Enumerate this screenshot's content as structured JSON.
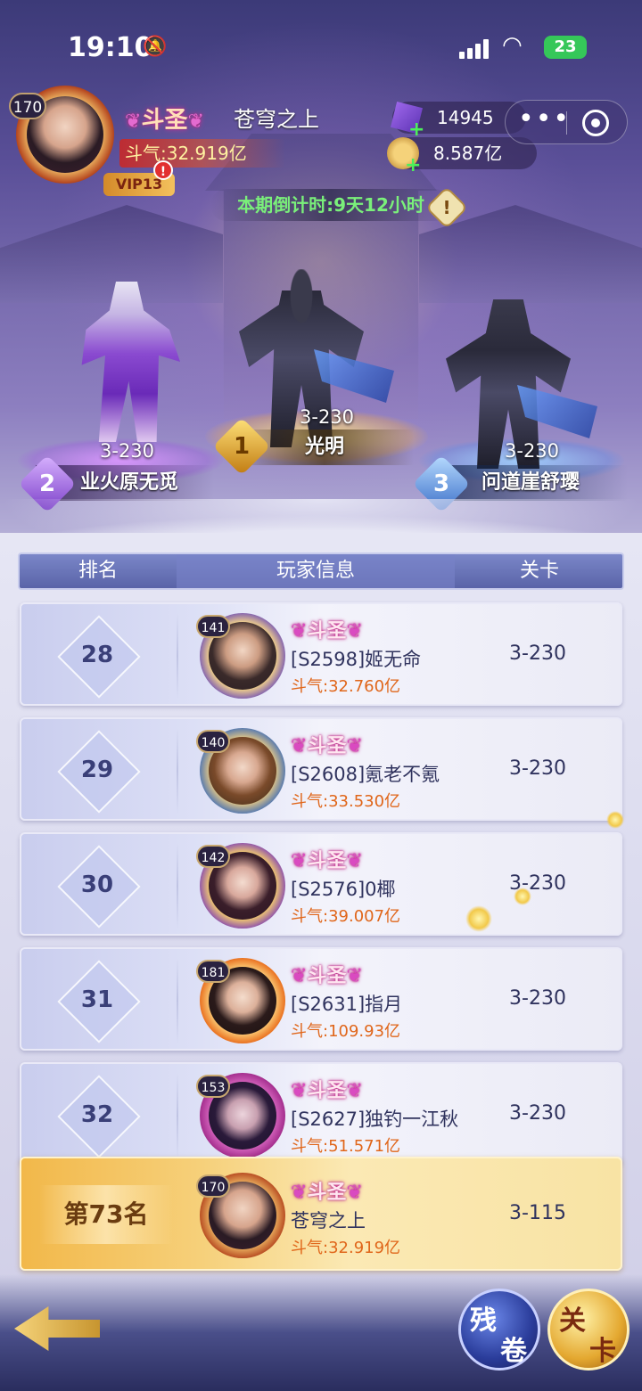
{
  "status_bar": {
    "time": "19:10",
    "battery": "23"
  },
  "player": {
    "level": "170",
    "title": "斗圣",
    "name": "苍穹之上",
    "power": "斗气:32.919亿",
    "vip": "VIP13",
    "vip_alert": "!"
  },
  "resources": {
    "gems": "14945",
    "gold": "8.587亿"
  },
  "countdown": "本期倒计时:9天12小时",
  "info_button": "!",
  "podium": [
    {
      "place": "1",
      "stage": "3-230",
      "name": "光明"
    },
    {
      "place": "2",
      "stage": "3-230",
      "name": "业火原无觅"
    },
    {
      "place": "3",
      "stage": "3-230",
      "name": "问道崖舒璎"
    }
  ],
  "table_header": {
    "rank": "排名",
    "info": "玩家信息",
    "stage": "关卡"
  },
  "rows": [
    {
      "rank": "28",
      "level": "141",
      "title": "斗圣",
      "name": "[S2598]姬无命",
      "power": "斗气:32.760亿",
      "stage": "3-230"
    },
    {
      "rank": "29",
      "level": "140",
      "title": "斗圣",
      "name": "[S2608]氪老不氪",
      "power": "斗气:33.530亿",
      "stage": "3-230"
    },
    {
      "rank": "30",
      "level": "142",
      "title": "斗圣",
      "name": "[S2576]0椰",
      "power": "斗气:39.007亿",
      "stage": "3-230"
    },
    {
      "rank": "31",
      "level": "181",
      "title": "斗圣",
      "name": "[S2631]指月",
      "power": "斗气:109.93亿",
      "stage": "3-230"
    },
    {
      "rank": "32",
      "level": "153",
      "title": "斗圣",
      "name": "[S2627]独钓一江秋",
      "power": "斗气:51.571亿",
      "stage": "3-230"
    }
  ],
  "self_row": {
    "rank": "第73名",
    "level": "170",
    "title": "斗圣",
    "name": "苍穹之上",
    "power": "斗气:32.919亿",
    "stage": "3-115"
  },
  "buttons": {
    "scroll_1": "残",
    "scroll_2": "卷",
    "stage_1": "关",
    "stage_2": "卡"
  },
  "colors": {
    "power_text": "#e0661a",
    "countdown": "#7af07a",
    "gold_row": "#f6d07a",
    "header_blue": "#5a64a8"
  }
}
